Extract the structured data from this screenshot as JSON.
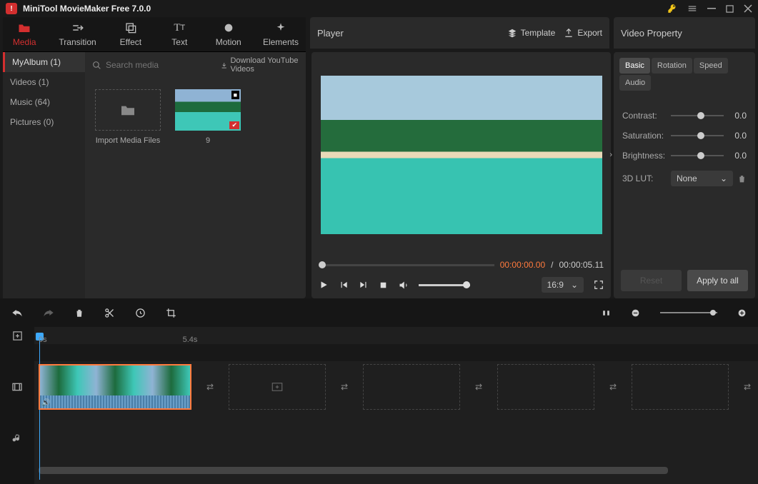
{
  "app": {
    "title": "MiniTool MovieMaker Free 7.0.0"
  },
  "tabs": {
    "media": "Media",
    "transition": "Transition",
    "effect": "Effect",
    "text": "Text",
    "motion": "Motion",
    "elements": "Elements"
  },
  "nav": {
    "album": "MyAlbum (1)",
    "videos": "Videos (1)",
    "music": "Music (64)",
    "pictures": "Pictures (0)"
  },
  "search": {
    "placeholder": "Search media"
  },
  "download_yt": "Download YouTube Videos",
  "media": {
    "import_label": "Import Media Files",
    "clip_label": "9"
  },
  "player": {
    "title": "Player",
    "template": "Template",
    "export": "Export",
    "cur": "00:00:00.00",
    "sep": " / ",
    "dur": "00:00:05.11",
    "aspect": "16:9"
  },
  "props": {
    "title": "Video Property",
    "tabs": {
      "basic": "Basic",
      "rotation": "Rotation",
      "speed": "Speed",
      "audio": "Audio"
    },
    "contrast_label": "Contrast:",
    "contrast_val": "0.0",
    "saturation_label": "Saturation:",
    "saturation_val": "0.0",
    "brightness_label": "Brightness:",
    "brightness_val": "0.0",
    "lut_label": "3D LUT:",
    "lut_val": "None",
    "reset": "Reset",
    "apply": "Apply to all"
  },
  "timeline": {
    "t0": "0s",
    "t1": "5.4s"
  }
}
